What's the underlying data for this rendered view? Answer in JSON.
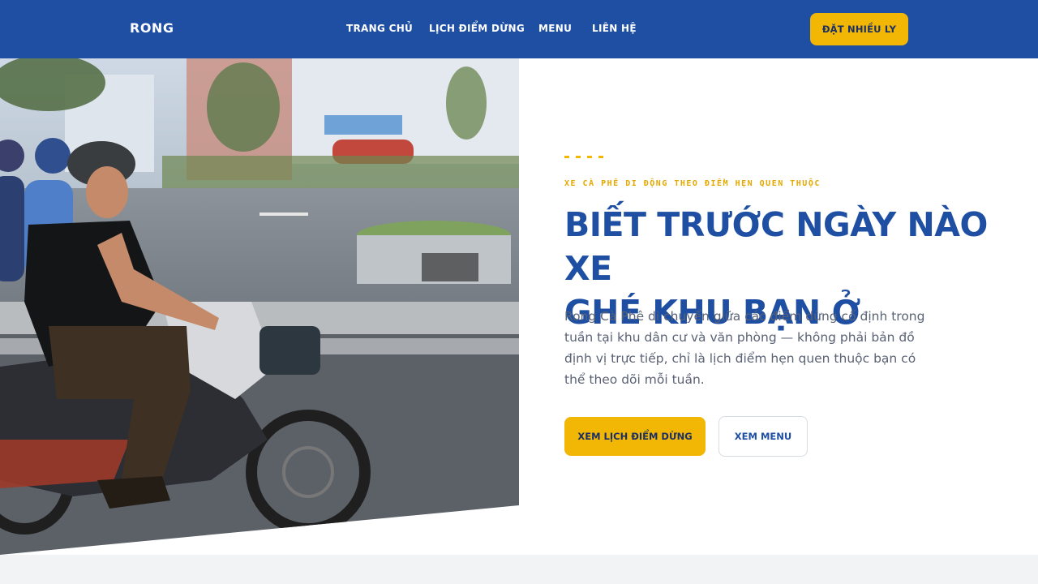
{
  "header": {
    "brand": "RONG",
    "nav": [
      {
        "label": "TRANG CHỦ"
      },
      {
        "label": "LỊCH ĐIỂM DỪNG"
      },
      {
        "label": "MENU"
      },
      {
        "label": "LIÊN HỆ"
      }
    ],
    "cta_label": "ĐẶT NHIỀU LY"
  },
  "hero": {
    "eyebrow": "XE CÀ PHÊ DI ĐỘNG THEO ĐIỂM HẸN QUEN THUỘC",
    "headline_line1": "BIẾT TRƯỚC NGÀY NÀO XE",
    "headline_line2": "GHÉ KHU BẠN Ở",
    "description": "Rong Cà Phê di chuyển giữa các điểm dừng cố định trong tuần tại khu dân cư và văn phòng — không phải bản đồ định vị trực tiếp, chỉ là lịch điểm hẹn quen thuộc bạn có thể theo dõi mỗi tuần.",
    "primary_button": "XEM LỊCH ĐIỂM DỪNG",
    "secondary_button": "XEM MENU"
  },
  "colors": {
    "brand_blue": "#1e4fa3",
    "accent_yellow": "#f2b705",
    "text_gray": "#5a6275"
  }
}
